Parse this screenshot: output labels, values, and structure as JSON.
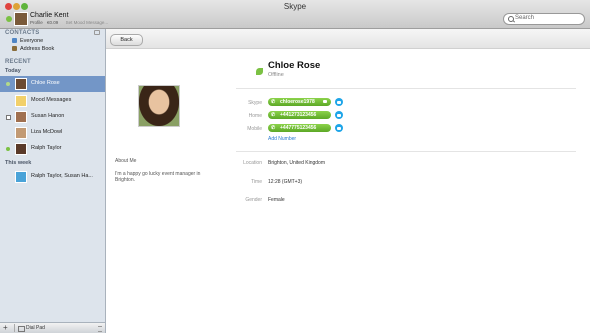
{
  "window": {
    "title": "Skype"
  },
  "profile": {
    "name": "Charlie Kent",
    "label": "Profile",
    "balance": "€0.09",
    "mood_placeholder": "Set Mood Message..."
  },
  "search": {
    "placeholder": "Search"
  },
  "sidebar": {
    "contacts_title": "CONTACTS",
    "contacts_links": [
      "Everyone",
      "Address Book"
    ],
    "recent_title": "RECENT",
    "today_label": "Today",
    "today_items": [
      {
        "label": "Chloe Rose",
        "selected": true
      },
      {
        "label": "Mood Messages"
      },
      {
        "label": "Susan Hanon"
      },
      {
        "label": "Liza McDowl"
      },
      {
        "label": "Ralph Taylor"
      }
    ],
    "this_week_label": "This week",
    "week_items": [
      {
        "label": "Ralph Taylor, Susan Ha..."
      }
    ]
  },
  "bottom_bar": {
    "add": "+",
    "dial_pad": "Dial Pad"
  },
  "toolbar": {
    "back_label": "Back"
  },
  "contact": {
    "name": "Chloe Rose",
    "status": "Offline",
    "fields": [
      {
        "label": "Skype",
        "value": "chloerose1978"
      },
      {
        "label": "Home",
        "value": "+441273123456"
      },
      {
        "label": "Mobile",
        "value": "+447775123456"
      }
    ],
    "add_number": "Add Number",
    "about_label": "About Me",
    "about_text": "I'm a happy go lucky event manager in Brighton.",
    "info": [
      {
        "label": "Location",
        "value": "Brighton, United Kingdom"
      },
      {
        "label": "Time",
        "value": "12:28 (GMT+3)"
      },
      {
        "label": "Gender",
        "value": "Female"
      }
    ]
  },
  "colors": {
    "accent": "#7396c7",
    "online": "#7bc143",
    "call_green": "#5ca826",
    "chat_blue": "#1ea5e8",
    "link": "#2b7bd0"
  }
}
